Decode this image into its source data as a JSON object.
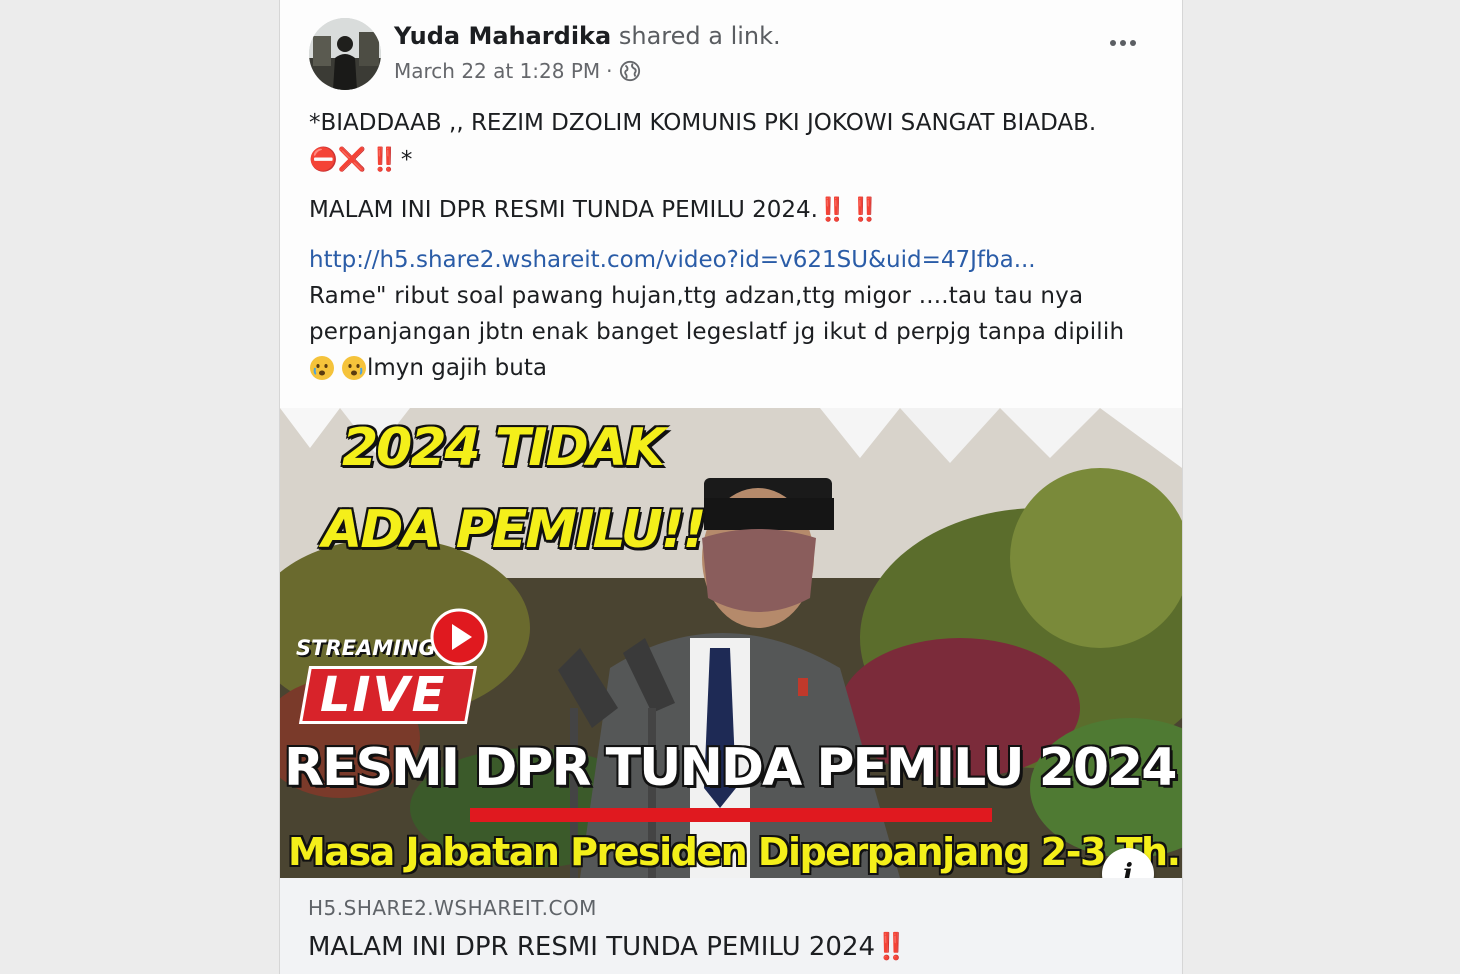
{
  "post": {
    "author": "Yuda Mahardika",
    "action": "shared a link.",
    "timestamp": "March 22 at 1:28 PM",
    "separator": "·",
    "privacy_icon": "globe-icon",
    "more_icon": "more-options-icon",
    "lines": {
      "line1": "*BIADDAAB ,, REZIM DZOLIM KOMUNIS PKI JOKOWI SANGAT BIADAB.",
      "line2_emoji": "⛔❌",
      "line2_bang": "‼️",
      "line2_tail": "*",
      "line3": "MALAM INI DPR RESMI TUNDA PEMILU 2024.",
      "line3_bang": "‼️ ‼️",
      "link": "http://h5.share2.wshareit.com/video?id=v621SU&uid=47Jfba...",
      "line5": "Rame\" ribut soal pawang hujan,ttg adzan,ttg migor ....tau tau nya",
      "line6": "perpanjangan jbtn enak banget legeslatf jg ikut d perpjg tanpa dipilih",
      "line7": "lmyn gajih buta"
    }
  },
  "thumbnail": {
    "headline_top_1": "2024 TIDAK",
    "headline_top_2": "ADA PEMILU!!",
    "streaming": "STREAMING",
    "live": "LIVE",
    "headline_main": "RESMI DPR TUNDA PEMILU 2024",
    "subline": "Masa Jabatan Presiden Diperpanjang 2-3 Th.",
    "info_glyph": "i"
  },
  "link_preview": {
    "domain": "H5.SHARE2.WSHAREIT.COM",
    "title": "MALAM INI DPR RESMI TUNDA PEMILU 2024",
    "title_bang": "‼️"
  },
  "colors": {
    "link_blue": "#2a5ca7",
    "headline_yellow": "#f4ef1a",
    "live_red": "#d8232a"
  }
}
